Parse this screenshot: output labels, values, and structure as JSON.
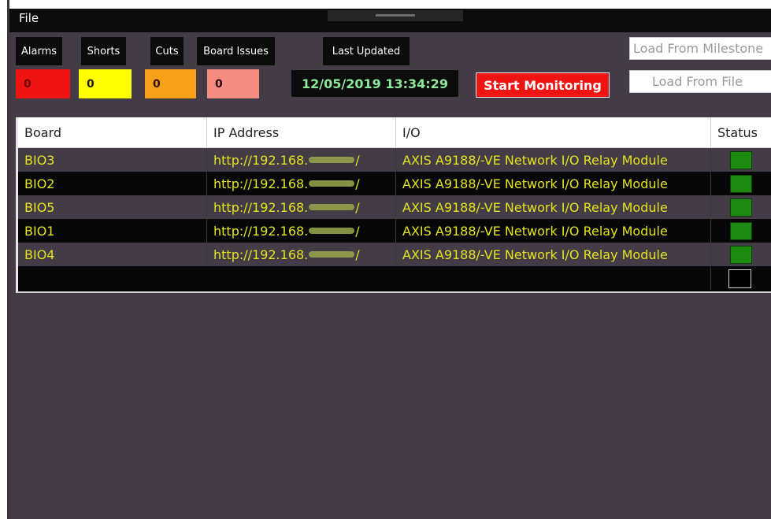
{
  "menu": {
    "file": "File"
  },
  "counters": {
    "alarms": {
      "label": "Alarms",
      "value": "0",
      "color": "#ee1411"
    },
    "shorts": {
      "label": "Shorts",
      "value": "0",
      "color": "#fffd00"
    },
    "cuts": {
      "label": "Cuts",
      "value": "0",
      "color": "#f9a01b"
    },
    "board_issues": {
      "label": "Board Issues",
      "value": "0",
      "color": "#f48c82"
    }
  },
  "last_updated": {
    "label": "Last Updated",
    "value": "12/05/2019 13:34:29"
  },
  "actions": {
    "start_monitoring": "Start Monitoring",
    "load_from_milestone": "Load From Milestone",
    "load_from_file": "Load From File"
  },
  "table": {
    "columns": [
      "Board",
      "IP Address",
      "I/O",
      "Status"
    ],
    "rows": [
      {
        "board": "BIO3",
        "ip_prefix": "http://192.168.",
        "ip_suffix": "/",
        "io": "AXIS A9188/-VE Network I/O Relay Module",
        "status": "green"
      },
      {
        "board": "BIO2",
        "ip_prefix": "http://192.168.",
        "ip_suffix": "/",
        "io": "AXIS A9188/-VE Network I/O Relay Module",
        "status": "green"
      },
      {
        "board": "BIO5",
        "ip_prefix": "http://192.168.",
        "ip_suffix": "/",
        "io": "AXIS A9188/-VE Network I/O Relay Module",
        "status": "green"
      },
      {
        "board": "BIO1",
        "ip_prefix": "http://192.168.",
        "ip_suffix": "/",
        "io": "AXIS A9188/-VE Network I/O Relay Module",
        "status": "green"
      },
      {
        "board": "BIO4",
        "ip_prefix": "http://192.168.",
        "ip_suffix": "/",
        "io": "AXIS A9188/-VE Network I/O Relay Module",
        "status": "green"
      }
    ]
  },
  "colors": {
    "background": "#433b46",
    "row_text": "#e4e41c",
    "status_ok": "#1f8a12",
    "timestamp_text": "#8ee89a"
  }
}
